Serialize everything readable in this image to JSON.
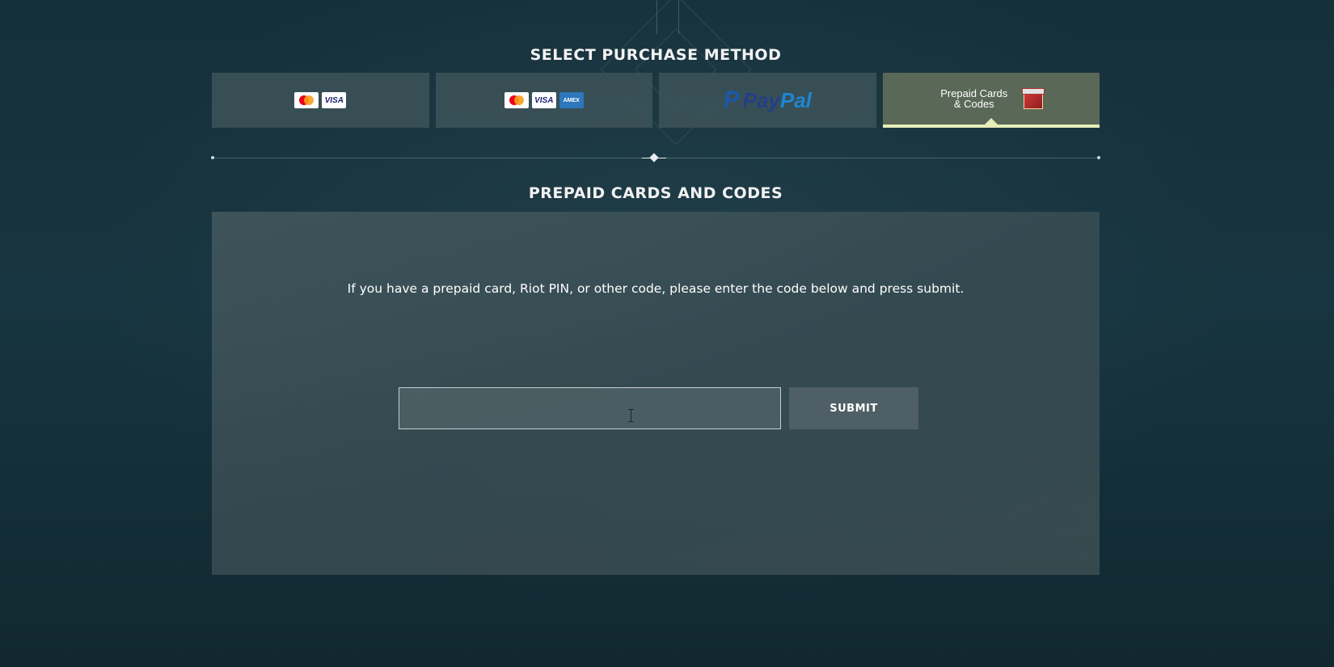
{
  "header": {
    "title": "SELECT PURCHASE METHOD"
  },
  "payment_tabs": [
    {
      "id": "cards",
      "icons": [
        "mastercard-icon",
        "visa-icon"
      ],
      "visa_text": "VISA",
      "active": false
    },
    {
      "id": "cards-amex",
      "icons": [
        "mastercard-icon",
        "visa-icon",
        "amex-icon"
      ],
      "visa_text": "VISA",
      "amex_text": "AMEX",
      "active": false
    },
    {
      "id": "paypal",
      "logo_p": "P",
      "logo_pay": "Pay",
      "logo_pal": "Pal",
      "active": false
    },
    {
      "id": "prepaid",
      "label": "Prepaid Cards & Codes",
      "icon": "gift-card-icon",
      "active": true
    }
  ],
  "prepaid_section": {
    "title": "PREPAID CARDS AND CODES",
    "instructions": "If you have a prepaid card, Riot PIN, or other code, please enter the code below and press submit.",
    "code_input": {
      "value": "",
      "placeholder": ""
    },
    "submit_label": "SUBMIT"
  },
  "colors": {
    "background": "#16303a",
    "tab": "#3e545a",
    "tab_active": "#5a6857",
    "tab_active_accent": "#e6edb9",
    "panel": "#485c61",
    "mastercard_red": "#eb001b",
    "mastercard_yellow": "#f79e1b",
    "visa_blue": "#1a1f71",
    "amex_blue": "#2e77bc",
    "paypal_dark": "#233f88",
    "paypal_light": "#1f86d0"
  }
}
